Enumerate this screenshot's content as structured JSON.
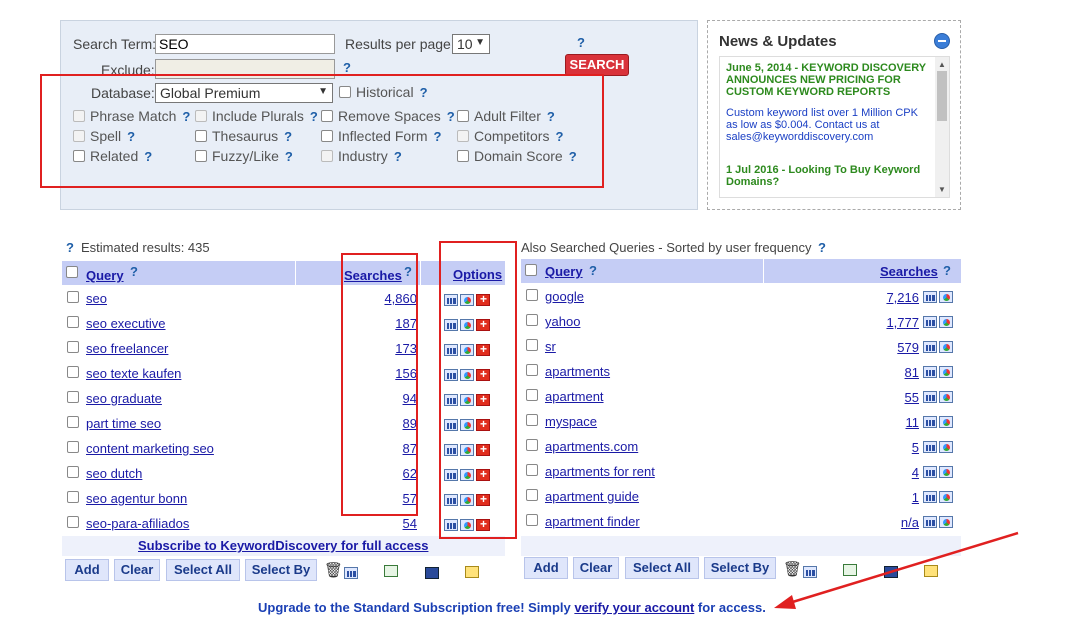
{
  "search": {
    "term_label": "Search Term:",
    "term_value": "SEO",
    "results_label": "Results per page:",
    "results_value": "10",
    "search_button": "SEARCH",
    "exclude_label": "Exclude:",
    "exclude_value": "",
    "database_label": "Database:",
    "database_value": "Global Premium",
    "historical_label": "Historical",
    "help": "?",
    "options": [
      {
        "label": "Phrase Match",
        "disabled": true
      },
      {
        "label": "Include Plurals",
        "disabled": true
      },
      {
        "label": "Remove Spaces",
        "disabled": false
      },
      {
        "label": "Adult Filter",
        "disabled": false
      },
      {
        "label": "Spell",
        "disabled": true
      },
      {
        "label": "Thesaurus",
        "disabled": false
      },
      {
        "label": "Inflected Form",
        "disabled": false
      },
      {
        "label": "Competitors",
        "disabled": true
      },
      {
        "label": "Related",
        "disabled": false
      },
      {
        "label": "Fuzzy/Like",
        "disabled": false
      },
      {
        "label": "Industry",
        "disabled": true
      },
      {
        "label": "Domain Score",
        "disabled": false
      }
    ]
  },
  "news": {
    "title": "News & Updates",
    "items": [
      {
        "headline": "June 5, 2014 - KEYWORD DISCOVERY ANNOUNCES NEW PRICING FOR CUSTOM KEYWORD REPORTS",
        "body": "Custom keyword list over 1 Million CPK as low as $0.004. Contact us at sales@keyworddiscovery.com"
      },
      {
        "headline": "1 Jul 2016 - Looking To Buy Keyword Domains?",
        "body": ""
      }
    ]
  },
  "left": {
    "estimated_label": "Estimated results: 435",
    "col_query": "Query",
    "col_searches": "Searches",
    "col_options": "Options",
    "rows": [
      {
        "query": "seo",
        "searches": "4,860"
      },
      {
        "query": "seo executive",
        "searches": "187"
      },
      {
        "query": "seo freelancer",
        "searches": "173"
      },
      {
        "query": "seo texte kaufen",
        "searches": "156"
      },
      {
        "query": "seo graduate",
        "searches": "94"
      },
      {
        "query": "part time seo",
        "searches": "89"
      },
      {
        "query": "content marketing seo",
        "searches": "87"
      },
      {
        "query": "seo dutch",
        "searches": "62"
      },
      {
        "query": "seo agentur bonn",
        "searches": "57"
      },
      {
        "query": "seo-para-afiliados",
        "searches": "54"
      }
    ],
    "subscribe_link": "Subscribe to KeywordDiscovery for full access",
    "buttons": [
      "Add",
      "Clear",
      "Select All",
      "Select By"
    ]
  },
  "right": {
    "title": "Also Searched Queries - Sorted by user frequency",
    "col_query": "Query",
    "col_searches": "Searches",
    "rows": [
      {
        "query": "google",
        "searches": "7,216"
      },
      {
        "query": "yahoo",
        "searches": "1,777"
      },
      {
        "query": "sr",
        "searches": "579"
      },
      {
        "query": "apartments",
        "searches": "81"
      },
      {
        "query": "apartment",
        "searches": "55"
      },
      {
        "query": "myspace",
        "searches": "11"
      },
      {
        "query": "apartments.com",
        "searches": "5"
      },
      {
        "query": "apartments for rent",
        "searches": "4"
      },
      {
        "query": "apartment guide",
        "searches": "1"
      },
      {
        "query": "apartment finder",
        "searches": "n/a"
      }
    ],
    "buttons": [
      "Add",
      "Clear",
      "Select All",
      "Select By"
    ]
  },
  "upgrade": {
    "prefix": "Upgrade to the Standard Subscription free! Simply ",
    "link": "verify your account",
    "suffix": " for access."
  },
  "colors": {
    "header_bg": "#c5cdf5",
    "annotation_red": "#e02020",
    "news_green": "#2d8a1e"
  }
}
